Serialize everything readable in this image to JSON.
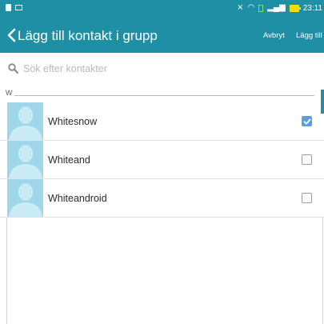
{
  "status_bar": {
    "time": "23:11",
    "icons": [
      "document-icon",
      "image-icon",
      "mute-icon",
      "wifi-icon",
      "signal-icon",
      "battery-icon"
    ]
  },
  "toolbar": {
    "title": "Lägg till kontakt i grupp",
    "cancel_label": "Avbryt",
    "add_label": "Lägg till",
    "background": "#1e8fa5"
  },
  "search": {
    "placeholder": "Sök efter kontakter",
    "value": ""
  },
  "section": {
    "letter": "W"
  },
  "contacts": [
    {
      "name": "Whitesnow",
      "checked": true
    },
    {
      "name": "Whiteand",
      "checked": false
    },
    {
      "name": "Whiteandroid",
      "checked": false
    }
  ],
  "colors": {
    "accent": "#1e8fa5",
    "avatar_bg": "#9fd6ea",
    "checkbox_checked": "#5b9fdc"
  }
}
